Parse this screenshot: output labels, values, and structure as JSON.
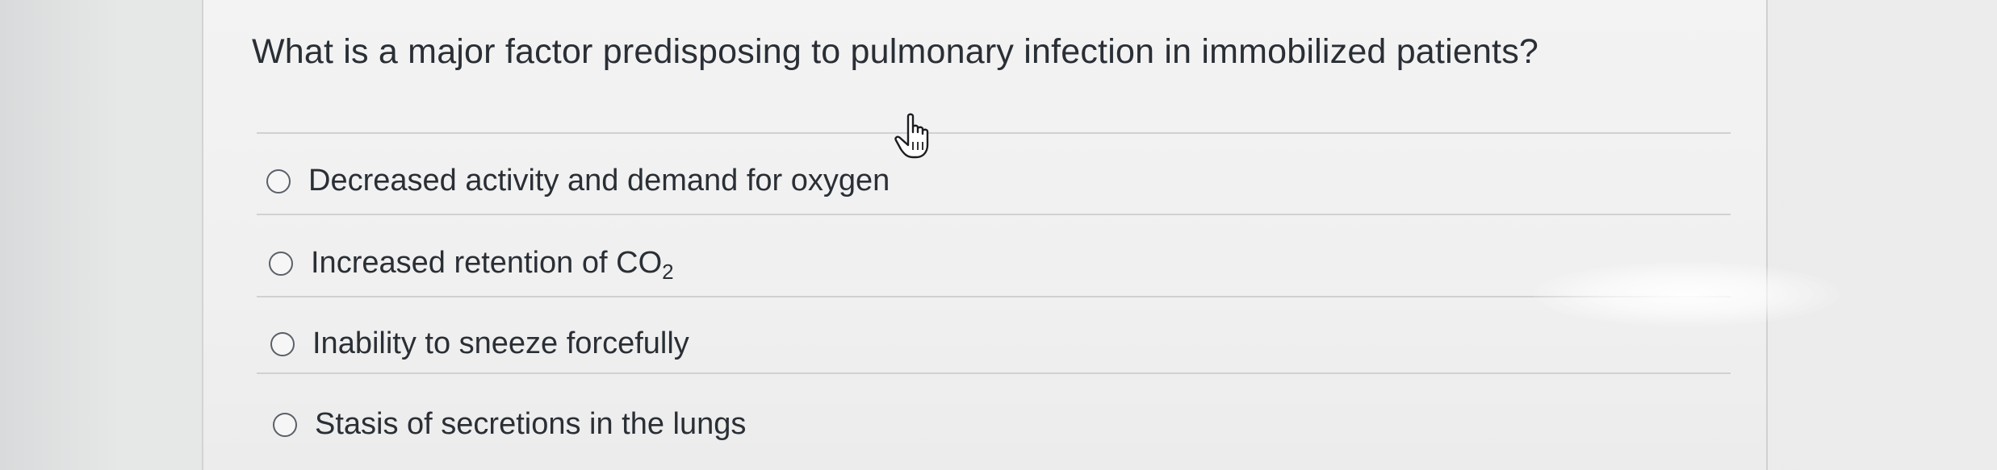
{
  "question": {
    "text": "What is a major factor predisposing to pulmonary infection in immobilized patients?"
  },
  "options": [
    {
      "label": "Decreased activity and demand for oxygen",
      "selected": false
    },
    {
      "label_prefix": "Increased retention of CO",
      "label_subscript": "2",
      "selected": false
    },
    {
      "label": "Inability to sneeze forcefully",
      "selected": false
    },
    {
      "label": "Stasis of secretions in the lungs",
      "selected": false
    }
  ],
  "cursor": {
    "icon": "hand-pointer-icon"
  },
  "colors": {
    "text": "#2a2f35",
    "divider": "#cfd1d3",
    "panel_background": "#f0f0f0",
    "radio_border": "#5a6068"
  }
}
